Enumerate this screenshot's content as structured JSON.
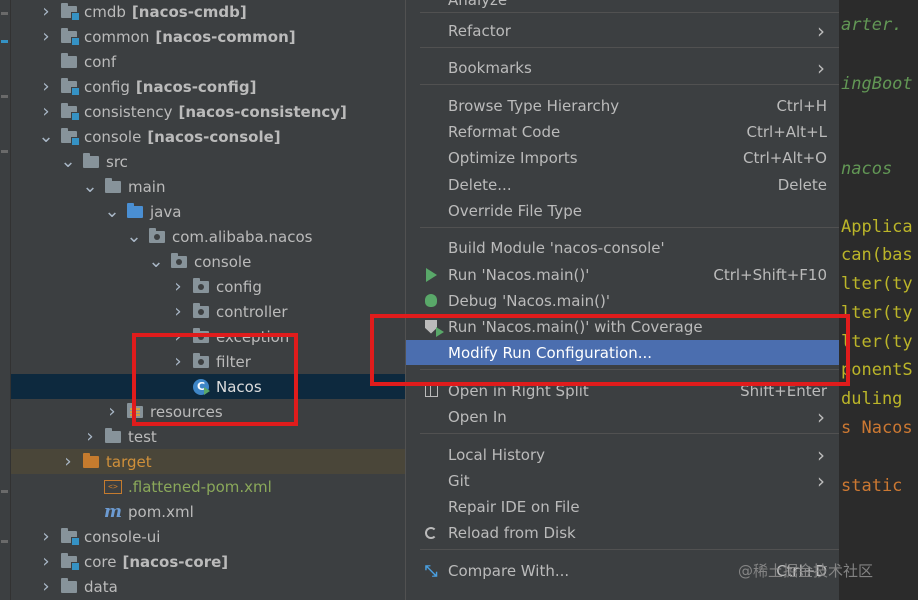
{
  "tree": [
    {
      "indent": 0,
      "arrow": "▶",
      "icon": "module",
      "label": "cmdb",
      "bold": "[nacos-cmdb]"
    },
    {
      "indent": 0,
      "arrow": "▶",
      "icon": "module",
      "label": "common",
      "bold": "[nacos-common]"
    },
    {
      "indent": 0,
      "arrow": "",
      "icon": "folder",
      "label": "conf",
      "bold": ""
    },
    {
      "indent": 0,
      "arrow": "▶",
      "icon": "module",
      "label": "config",
      "bold": "[nacos-config]"
    },
    {
      "indent": 0,
      "arrow": "▶",
      "icon": "module",
      "label": "consistency",
      "bold": "[nacos-consistency]"
    },
    {
      "indent": 0,
      "arrow": "▼",
      "icon": "module",
      "label": "console",
      "bold": "[nacos-console]"
    },
    {
      "indent": 1,
      "arrow": "▼",
      "icon": "folder",
      "label": "src",
      "bold": ""
    },
    {
      "indent": 2,
      "arrow": "▼",
      "icon": "folder",
      "label": "main",
      "bold": ""
    },
    {
      "indent": 3,
      "arrow": "▼",
      "icon": "source",
      "label": "java",
      "bold": ""
    },
    {
      "indent": 4,
      "arrow": "▼",
      "icon": "package",
      "label": "com.alibaba.nacos",
      "bold": ""
    },
    {
      "indent": 5,
      "arrow": "▼",
      "icon": "package",
      "label": "console",
      "bold": ""
    },
    {
      "indent": 6,
      "arrow": "▶",
      "icon": "package",
      "label": "config",
      "bold": ""
    },
    {
      "indent": 6,
      "arrow": "▶",
      "icon": "package",
      "label": "controller",
      "bold": ""
    },
    {
      "indent": 6,
      "arrow": "▶",
      "icon": "package",
      "label": "exception",
      "bold": ""
    },
    {
      "indent": 6,
      "arrow": "▶",
      "icon": "package",
      "label": "filter",
      "bold": ""
    },
    {
      "indent": 6,
      "arrow": "",
      "icon": "class",
      "label": "Nacos",
      "bold": "",
      "selected": true
    },
    {
      "indent": 3,
      "arrow": "▶",
      "icon": "resources",
      "label": "resources",
      "bold": ""
    },
    {
      "indent": 2,
      "arrow": "▶",
      "icon": "folder",
      "label": "test",
      "bold": ""
    },
    {
      "indent": 1,
      "arrow": "▶",
      "icon": "target",
      "label": "target",
      "bold": "",
      "style": "orange",
      "excluded": true
    },
    {
      "indent": 2,
      "arrow": "",
      "icon": "xml",
      "label": ".flattened-pom.xml",
      "bold": "",
      "style": "green"
    },
    {
      "indent": 2,
      "arrow": "",
      "icon": "maven",
      "label": "pom.xml",
      "bold": ""
    },
    {
      "indent": 0,
      "arrow": "▶",
      "icon": "module",
      "label": "console-ui",
      "bold": ""
    },
    {
      "indent": 0,
      "arrow": "▶",
      "icon": "module",
      "label": "core",
      "bold": "[nacos-core]"
    },
    {
      "indent": 0,
      "arrow": "▶",
      "icon": "folder",
      "label": "data",
      "bold": ""
    }
  ],
  "menu": {
    "top_partial": "Analyze",
    "items": [
      {
        "label": "Refactor",
        "shortcut": "",
        "submenu": true,
        "icon": "",
        "sep_after": true
      },
      {
        "label": "Bookmarks",
        "shortcut": "",
        "submenu": true,
        "icon": "",
        "sep_after": true
      },
      {
        "label": "Browse Type Hierarchy",
        "shortcut": "Ctrl+H",
        "submenu": false,
        "icon": ""
      },
      {
        "label": "Reformat Code",
        "shortcut": "Ctrl+Alt+L",
        "submenu": false,
        "icon": ""
      },
      {
        "label": "Optimize Imports",
        "shortcut": "Ctrl+Alt+O",
        "submenu": false,
        "icon": ""
      },
      {
        "label": "Delete...",
        "shortcut": "Delete",
        "submenu": false,
        "icon": ""
      },
      {
        "label": "Override File Type",
        "shortcut": "",
        "submenu": false,
        "icon": "",
        "sep_after": true
      },
      {
        "label": "Build Module 'nacos-console'",
        "shortcut": "",
        "submenu": false,
        "icon": ""
      },
      {
        "label": "Run 'Nacos.main()'",
        "shortcut": "Ctrl+Shift+F10",
        "submenu": false,
        "icon": "run"
      },
      {
        "label": "Debug 'Nacos.main()'",
        "shortcut": "",
        "submenu": false,
        "icon": "debug"
      },
      {
        "label": "Run 'Nacos.main()' with Coverage",
        "shortcut": "",
        "submenu": false,
        "icon": "coverage"
      },
      {
        "label": "Modify Run Configuration...",
        "shortcut": "",
        "submenu": false,
        "icon": "",
        "highlighted": true,
        "sep_after": true
      },
      {
        "label": "Open in Right Split",
        "shortcut": "Shift+Enter",
        "submenu": false,
        "icon": "split"
      },
      {
        "label": "Open In",
        "shortcut": "",
        "submenu": true,
        "icon": "",
        "sep_after": true
      },
      {
        "label": "Local History",
        "shortcut": "",
        "submenu": true,
        "icon": ""
      },
      {
        "label": "Git",
        "shortcut": "",
        "submenu": true,
        "icon": ""
      },
      {
        "label": "Repair IDE on File",
        "shortcut": "",
        "submenu": false,
        "icon": ""
      },
      {
        "label": "Reload from Disk",
        "shortcut": "",
        "submenu": false,
        "icon": "reload",
        "sep_after": true
      },
      {
        "label": "Compare With...",
        "shortcut": "Ctrl+D",
        "submenu": false,
        "icon": "compare"
      }
    ]
  },
  "editor_lines": [
    {
      "text": "arter.",
      "cls": "c-it"
    },
    {
      "text": "ingBoot",
      "cls": "c-it"
    },
    {
      "text": "nacos",
      "cls": "c-it"
    },
    {
      "text": "Applica",
      "cls": "c-cls"
    },
    {
      "text": "can(bas",
      "cls": "c-cls"
    },
    {
      "text": "lter(ty",
      "cls": "c-cls"
    },
    {
      "text": "lter(ty",
      "cls": "c-cls"
    },
    {
      "text": "lter(ty",
      "cls": "c-cls"
    },
    {
      "text": "ponentS",
      "cls": "c-cls"
    },
    {
      "text": "duling",
      "cls": "c-cls"
    },
    {
      "text": "s Nacos",
      "cls": "c-kw"
    },
    {
      "text": "static",
      "cls": "c-kw"
    }
  ],
  "watermark": "@稀土掘金技术社区",
  "colors": {
    "highlight": "#4b6eaf",
    "selection": "#0d293e",
    "annotation_red": "#e01c1c"
  }
}
